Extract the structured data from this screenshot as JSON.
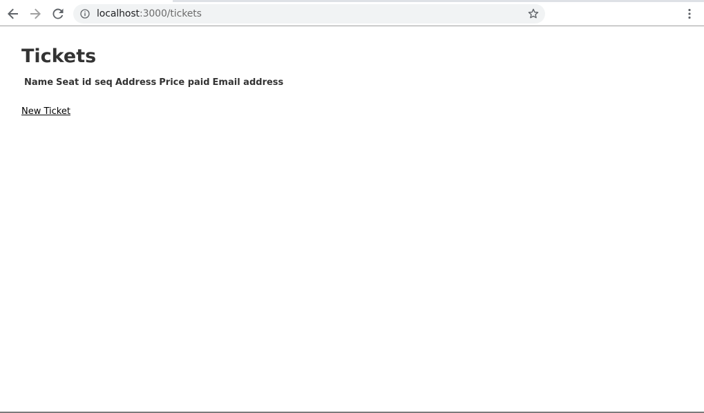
{
  "browser": {
    "url_host": "localhost",
    "url_path": ":3000/tickets",
    "icons": {
      "back": "arrow-left-icon",
      "forward": "arrow-right-icon",
      "reload": "reload-icon",
      "site_info": "info-icon",
      "bookmark": "star-icon",
      "menu": "kebab-menu-icon"
    }
  },
  "page": {
    "title": "Tickets",
    "table": {
      "headers": [
        "Name",
        "Seat id seq",
        "Address",
        "Price paid",
        "Email address"
      ],
      "rows": []
    },
    "new_link_label": "New Ticket"
  }
}
